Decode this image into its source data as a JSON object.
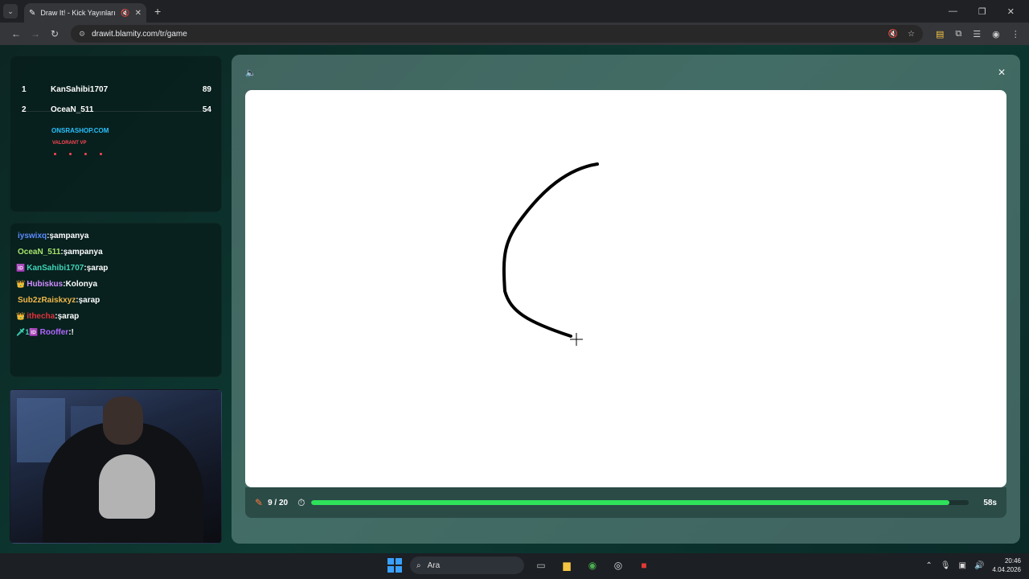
{
  "browser": {
    "tab_title": "Draw It! - Kick Yayınları İçin",
    "tab_favicon": "pencil-favicon",
    "url": "drawit.blamity.com/tr/game",
    "new_tab_symbol": "+",
    "window_controls": [
      "—",
      "❐",
      "✕"
    ]
  },
  "scoreboard": {
    "rows": [
      {
        "rank": "1",
        "name": "KanSahibi1707",
        "points": "89"
      },
      {
        "rank": "2",
        "name": "OceaN_511",
        "points": "54"
      }
    ],
    "badge_line1": "ONSRASHOP.COM",
    "badge_line2": "VALORANT VP"
  },
  "chat": {
    "messages": [
      {
        "user": "iyswixq",
        "text": "şampanya",
        "color": "#5b8cff",
        "icons": ""
      },
      {
        "user": "OceaN_511",
        "text": "şampanya",
        "color": "#a6e36b",
        "icons": ""
      },
      {
        "user": "KanSahibi1707",
        "text": "şarap",
        "color": "#3fd4b8",
        "icons": "🆔"
      },
      {
        "user": "Hubiskus",
        "text": "Kolonya",
        "color": "#d08cff",
        "icons": "👑"
      },
      {
        "user": "Sub2zRaiskxyz",
        "text": "şarap",
        "color": "#f0b84a",
        "icons": ""
      },
      {
        "user": "ithecha",
        "text": "şarap",
        "color": "#e0323c",
        "icons": "👑"
      },
      {
        "user": "Rooffer",
        "text": "!",
        "color": "#b065ff",
        "icons": "🗡1🆔"
      }
    ]
  },
  "game": {
    "round_text": "9 / 20",
    "time_left": "58s",
    "timer_fraction": 0.97,
    "colors": {
      "accent_green": "#2ee05a",
      "pencil_orange": "#ff7a3a"
    }
  },
  "taskbar": {
    "search_placeholder": "Ara",
    "time": "20:46",
    "date": "4.04.2026"
  }
}
